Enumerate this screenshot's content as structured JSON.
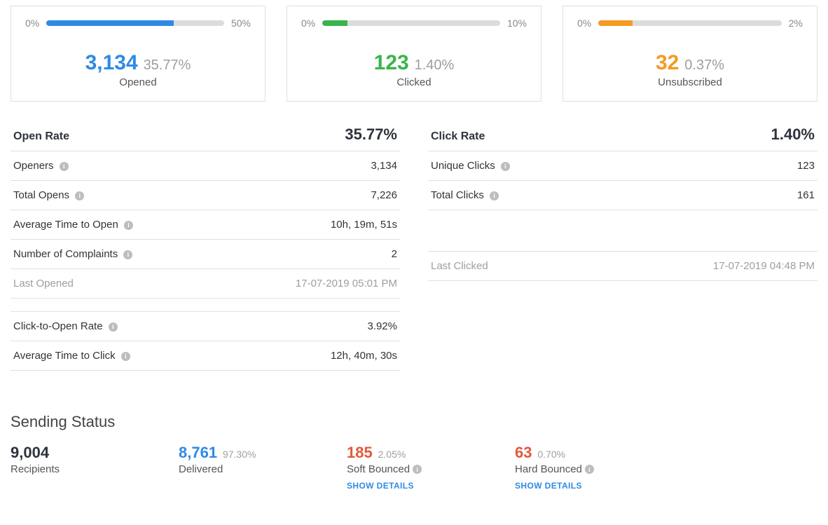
{
  "cards": {
    "opened": {
      "left_pct": "0%",
      "right_pct": "50%",
      "fill_pct": 71.5,
      "count": "3,134",
      "rate": "35.77%",
      "label": "Opened"
    },
    "clicked": {
      "left_pct": "0%",
      "right_pct": "10%",
      "fill_pct": 14,
      "count": "123",
      "rate": "1.40%",
      "label": "Clicked"
    },
    "unsub": {
      "left_pct": "0%",
      "right_pct": "2%",
      "fill_pct": 18.5,
      "count": "32",
      "rate": "0.37%",
      "label": "Unsubscribed"
    }
  },
  "open_stats": {
    "title": "Open Rate",
    "rate": "35.77%",
    "rows": {
      "openers": {
        "label": "Openers",
        "value": "3,134"
      },
      "total_opens": {
        "label": "Total Opens",
        "value": "7,226"
      },
      "avg_time_open": {
        "label": "Average Time to Open",
        "value": "10h, 19m, 51s"
      },
      "complaints": {
        "label": "Number of Complaints",
        "value": "2"
      },
      "last_opened": {
        "label": "Last Opened",
        "value": "17-07-2019 05:01 PM"
      },
      "cto_rate": {
        "label": "Click-to-Open Rate",
        "value": "3.92%"
      },
      "avg_time_click": {
        "label": "Average Time to Click",
        "value": "12h, 40m, 30s"
      }
    }
  },
  "click_stats": {
    "title": "Click Rate",
    "rate": "1.40%",
    "rows": {
      "unique_clicks": {
        "label": "Unique Clicks",
        "value": "123"
      },
      "total_clicks": {
        "label": "Total Clicks",
        "value": "161"
      },
      "last_clicked": {
        "label": "Last Clicked",
        "value": "17-07-2019 04:48 PM"
      }
    }
  },
  "sending": {
    "title": "Sending Status",
    "recipients": {
      "count": "9,004",
      "label": "Recipients"
    },
    "delivered": {
      "count": "8,761",
      "pct": "97.30%",
      "label": "Delivered"
    },
    "soft_bounce": {
      "count": "185",
      "pct": "2.05%",
      "label": "Soft Bounced",
      "details": "SHOW DETAILS"
    },
    "hard_bounce": {
      "count": "63",
      "pct": "0.70%",
      "label": "Hard Bounced",
      "details": "SHOW DETAILS"
    }
  }
}
